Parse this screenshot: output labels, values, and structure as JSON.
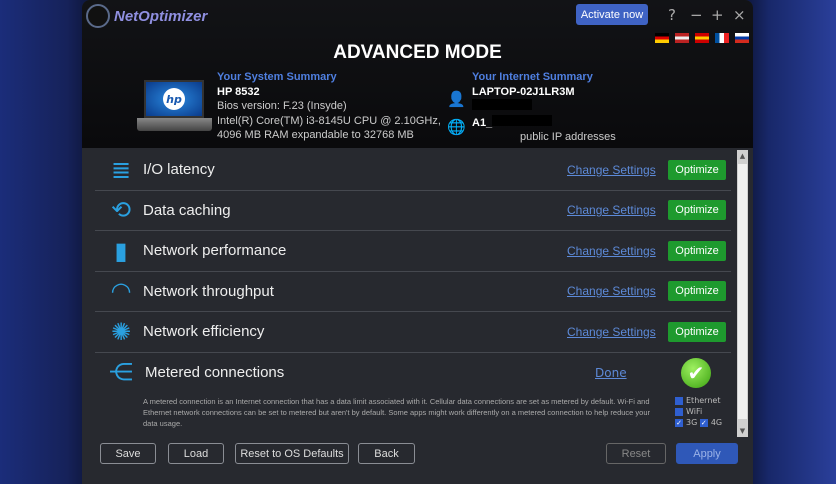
{
  "app": {
    "name": "NetOptimizer",
    "activate": "Activate now",
    "controls": [
      "?",
      "−",
      "+",
      "×"
    ]
  },
  "flags": [
    {
      "name": "german-flag",
      "colors": [
        "#000",
        "#d00",
        "#fc0"
      ]
    },
    {
      "name": "us-flag",
      "colors": [
        "#b22",
        "#eee",
        "#b22"
      ]
    },
    {
      "name": "spanish-flag",
      "colors": [
        "#c00",
        "#fc0",
        "#c00"
      ]
    },
    {
      "name": "french-flag",
      "colors": [
        "#0050a0",
        "#fff",
        "#e22"
      ]
    },
    {
      "name": "russian-flag",
      "colors": [
        "#fff",
        "#0039a6",
        "#d52b1e"
      ]
    }
  ],
  "title": "ADVANCED MODE",
  "system": {
    "heading": "Your System Summary",
    "model": "HP 8532",
    "bios": "Bios version: F.23 (Insyde)",
    "cpu": "Intel(R) Core(TM) i3-8145U CPU @ 2.10GHz,",
    "ram": "4096 MB RAM expandable to 32768 MB"
  },
  "internet": {
    "heading": "Your Internet Summary",
    "host": "LAPTOP-02J1LR3M",
    "isp": "A1_",
    "ip": "public IP addresses"
  },
  "rows": [
    {
      "label": "I/O latency",
      "link": "Change Settings",
      "action": "Optimize",
      "icon": "≣"
    },
    {
      "label": "Data caching",
      "link": "Change Settings",
      "action": "Optimize",
      "icon": "⟲"
    },
    {
      "label": "Network performance",
      "link": "Change Settings",
      "action": "Optimize",
      "icon": "▮"
    },
    {
      "label": "Network throughput",
      "link": "Change Settings",
      "action": "Optimize",
      "icon": "◠"
    },
    {
      "label": "Network efficiency",
      "link": "Change Settings",
      "action": "Optimize",
      "icon": "✺"
    }
  ],
  "metered": {
    "label": "Metered connections",
    "link": "Done",
    "description": "A metered connection is an Internet connection that has a data limit associated with it. Cellular data connections are set as metered by default. Wi-Fi and Ethernet network connections can be set to metered but aren't by default. Some apps might work differently on a metered connection to help reduce your data usage.",
    "options": {
      "ethernet": "Ethernet",
      "wifi": "WiFi",
      "g3": "3G",
      "g4": "4G"
    }
  },
  "buttons": {
    "save": "Save",
    "load": "Load",
    "reset_os": "Reset to OS Defaults",
    "back": "Back",
    "reset": "Reset",
    "apply": "Apply"
  }
}
